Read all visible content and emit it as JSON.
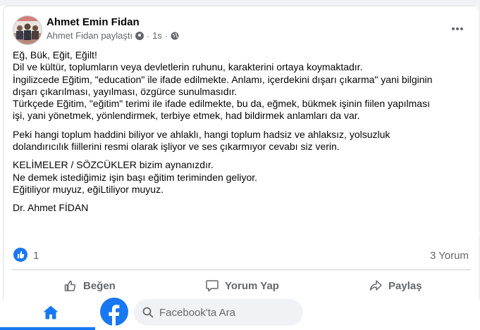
{
  "post": {
    "author": "Ahmet Emin Fidan",
    "shared_by": "Ahmet Fidan paylaştı",
    "time": "1s",
    "paragraphs": [
      [
        "Eğ, Bük, Eğit, Eğilt!",
        "Dil ve kültür, toplumların veya devletlerin ruhunu, karakterini ortaya koymaktadır.",
        "İngilizcede Eğitim, \"education\" ile ifade edilmekte. Anlamı, içerdekini dışarı çıkarma\" yani bilginin",
        "dışarı çıkarılması, yayılması, özgürce sunulmasıdır.",
        "Türkçede Eğitim, \"eğitim\" terimi ile ifade edilmekte, bu da, eğmek, bükmek işinin fiilen yapılması",
        "işi, yani yönetmek, yönlendirmek, terbiye etmek, had bildirmek anlamları da var."
      ],
      [
        "Peki hangi toplum haddini biliyor ve ahlaklı, hangi toplum hadsiz ve ahlaksız, yolsuzluk",
        "dolandırıcılık fiillerini resmi olarak işliyor ve ses çıkarmıyor cevabı siz verin."
      ],
      [
        "KELİMELER / SÖZCÜKLER bizim aynanızdır.",
        "Ne demek istediğimiz işin başı eğitim teriminden geliyor.",
        "Eğitiliyor muyuz, eğiLtiliyor muyuz."
      ],
      [
        "Dr. Ahmet FİDAN"
      ]
    ]
  },
  "stats": {
    "likes": "1",
    "comments": "3 Yorum"
  },
  "actions": {
    "like": "Beğen",
    "comment": "Yorum Yap",
    "share": "Paylaş"
  },
  "nav": {
    "search_placeholder": "Facebook'ta Ara"
  },
  "colors": {
    "accent": "#1877f2",
    "secondary_text": "#65676b"
  }
}
